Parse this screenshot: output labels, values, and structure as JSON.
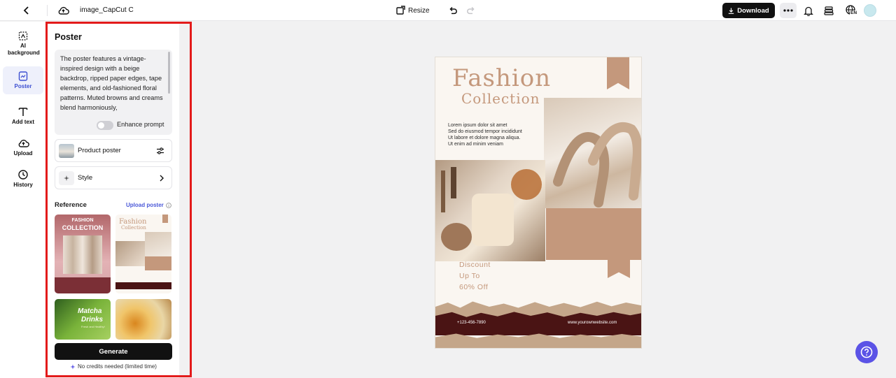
{
  "header": {
    "file_name": "image_CapCut C",
    "resize_label": "Resize",
    "download_label": "Download",
    "language_badge": "EN"
  },
  "rail": {
    "items": [
      {
        "label": "AI background",
        "icon": "ai-background-icon"
      },
      {
        "label": "Poster",
        "icon": "poster-icon"
      },
      {
        "label": "Add text",
        "icon": "text-icon"
      },
      {
        "label": "Upload",
        "icon": "upload-icon"
      },
      {
        "label": "History",
        "icon": "history-icon"
      }
    ]
  },
  "panel": {
    "title": "Poster",
    "prompt_text": "The poster features a vintage-inspired design with a beige backdrop, ripped paper edges, tape elements, and old-fashioned floral patterns. Muted browns and creams blend harmoniously,",
    "enhance_label": "Enhance prompt",
    "enhance_on": false,
    "product_label": "Product poster",
    "style_label": "Style",
    "reference_label": "Reference",
    "upload_label": "Upload poster",
    "thumbs": [
      {
        "line1": "FASHION",
        "line2": "COLLECTION"
      },
      {
        "line1": "Fashion",
        "line2": "Collection"
      },
      {
        "line1": "Matcha",
        "line2": "Drinks",
        "line3": "Fresh and Healthy!"
      },
      {
        "line1": ""
      }
    ],
    "generate_label": "Generate",
    "credits_label": "No credits needed (limited time)"
  },
  "poster": {
    "title_line1": "Fashion",
    "title_line2": "Collection",
    "lorem_lines": [
      "Lorem ipsum dolor sit amet",
      "Sed do eiusmod tempor incididunt",
      "Ut labore et dolore magna aliqua.",
      "Ut enim ad minim veniam"
    ],
    "discount_lines": [
      "Discount",
      "Up To",
      "60% Off"
    ],
    "phone": "+123-456-7890",
    "website": "www.yourownwebsite.com"
  },
  "colors": {
    "accent": "#c4987c",
    "highlight_border": "#e31b1b",
    "primary_button": "#111111",
    "help_button": "#5b53e6",
    "link": "#4a58d8"
  }
}
